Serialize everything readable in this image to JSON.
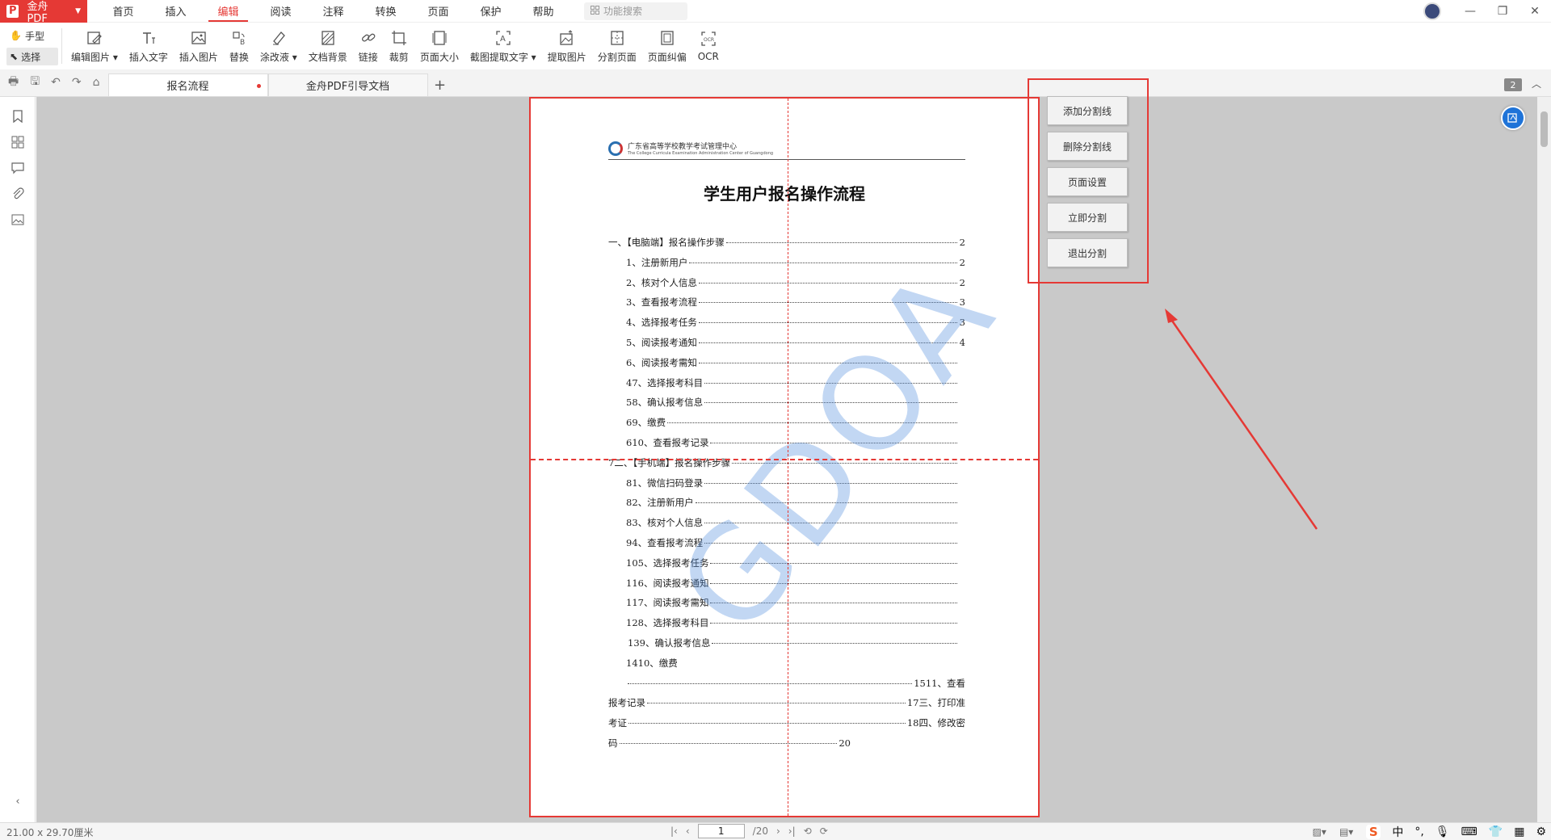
{
  "app": {
    "name": "金舟PDF",
    "logo_glyph": "P",
    "brand_color": "#e53935"
  },
  "menu": {
    "tabs": [
      "首页",
      "插入",
      "编辑",
      "阅读",
      "注释",
      "转换",
      "页面",
      "保护",
      "帮助"
    ],
    "active_tab": "编辑",
    "search_placeholder": "功能搜索"
  },
  "modes": {
    "hand": "手型",
    "select": "选择"
  },
  "tools": [
    {
      "label": "编辑图片",
      "icon": "edit-image-icon",
      "dropdown": true
    },
    {
      "label": "插入文字",
      "icon": "insert-text-icon"
    },
    {
      "label": "插入图片",
      "icon": "insert-image-icon"
    },
    {
      "label": "替换",
      "icon": "replace-icon"
    },
    {
      "label": "涂改液",
      "icon": "eraser-icon",
      "dropdown": true
    },
    {
      "label": "文档背景",
      "icon": "background-icon"
    },
    {
      "label": "链接",
      "icon": "link-icon"
    },
    {
      "label": "裁剪",
      "icon": "crop-icon"
    },
    {
      "label": "页面大小",
      "icon": "page-size-icon"
    },
    {
      "label": "截图提取文字",
      "icon": "screenshot-ocr-icon",
      "dropdown": true
    },
    {
      "label": "提取图片",
      "icon": "extract-image-icon"
    },
    {
      "label": "分割页面",
      "icon": "split-page-icon"
    },
    {
      "label": "页面纠偏",
      "icon": "deskew-icon"
    },
    {
      "label": "OCR",
      "icon": "ocr-icon"
    }
  ],
  "doc_tabs": [
    {
      "label": "报名流程",
      "active": true,
      "modified": true
    },
    {
      "label": "金舟PDF引导文档",
      "active": false
    }
  ],
  "page_badge": "2",
  "document": {
    "org_cn": "广东省高等学校教学考试管理中心",
    "org_en": "The College Curricula Examination Administration Center of Guangdong",
    "title": "学生用户报名操作流程",
    "watermark": "GDOA",
    "toc": [
      {
        "label": "一、【电脑端】报名操作步骤",
        "page": "2",
        "indent": 0
      },
      {
        "label": "1、注册新用户",
        "page": "2",
        "indent": 1
      },
      {
        "label": "2、核对个人信息",
        "page": "2",
        "indent": 1
      },
      {
        "label": "3、查看报考流程",
        "page": "3",
        "indent": 1
      },
      {
        "label": "4、选择报考任务",
        "page": "3",
        "indent": 1
      },
      {
        "label": "5、阅读报考通知",
        "page": "4",
        "indent": 1
      },
      {
        "label": "6、阅读报考需知",
        "page": "",
        "indent": 1
      },
      {
        "label": "47、选择报考科目",
        "page": "",
        "indent": 1
      },
      {
        "label": "58、确认报考信息",
        "page": "",
        "indent": 1
      },
      {
        "label": "69、缴费",
        "page": "",
        "indent": 1
      },
      {
        "label": "610、查看报考记录",
        "page": "",
        "indent": 1
      },
      {
        "label": "7二、【手机端】报名操作步骤",
        "page": "",
        "indent": 0
      },
      {
        "label": "81、微信扫码登录",
        "page": "",
        "indent": 1
      },
      {
        "label": "82、注册新用户",
        "page": "",
        "indent": 1
      },
      {
        "label": "83、核对个人信息",
        "page": "",
        "indent": 1
      },
      {
        "label": "94、查看报考流程",
        "page": "",
        "indent": 1
      },
      {
        "label": "105、选择报考任务",
        "page": "",
        "indent": 1
      },
      {
        "label": "116、阅读报考通知",
        "page": "",
        "indent": 1
      },
      {
        "label": "117、阅读报考需知",
        "page": "",
        "indent": 1
      },
      {
        "label": "128、选择报考科目",
        "page": "",
        "indent": 1
      },
      {
        "label": "139、确认报考信息",
        "page": "",
        "indent": 2
      }
    ],
    "toc_tail": [
      {
        "text": "1410、缴费",
        "type": "plain"
      },
      {
        "pre": "",
        "post": "1511、查看",
        "type": "dotted"
      },
      {
        "pre": "报考记录",
        "post": "17三、打印准",
        "type": "dotted"
      },
      {
        "pre": "考证",
        "post": "18四、修改密",
        "type": "dotted"
      },
      {
        "pre": "码",
        "post": "20",
        "type": "dotted"
      }
    ]
  },
  "split_panel": {
    "buttons": [
      "添加分割线",
      "删除分割线",
      "页面设置",
      "立即分割",
      "退出分割"
    ]
  },
  "status": {
    "dimensions": "21.00 x 29.70厘米",
    "current_page": "1",
    "total_pages": "/20"
  },
  "ime": {
    "logo": "S",
    "lang": "中",
    "punct": "°,"
  }
}
